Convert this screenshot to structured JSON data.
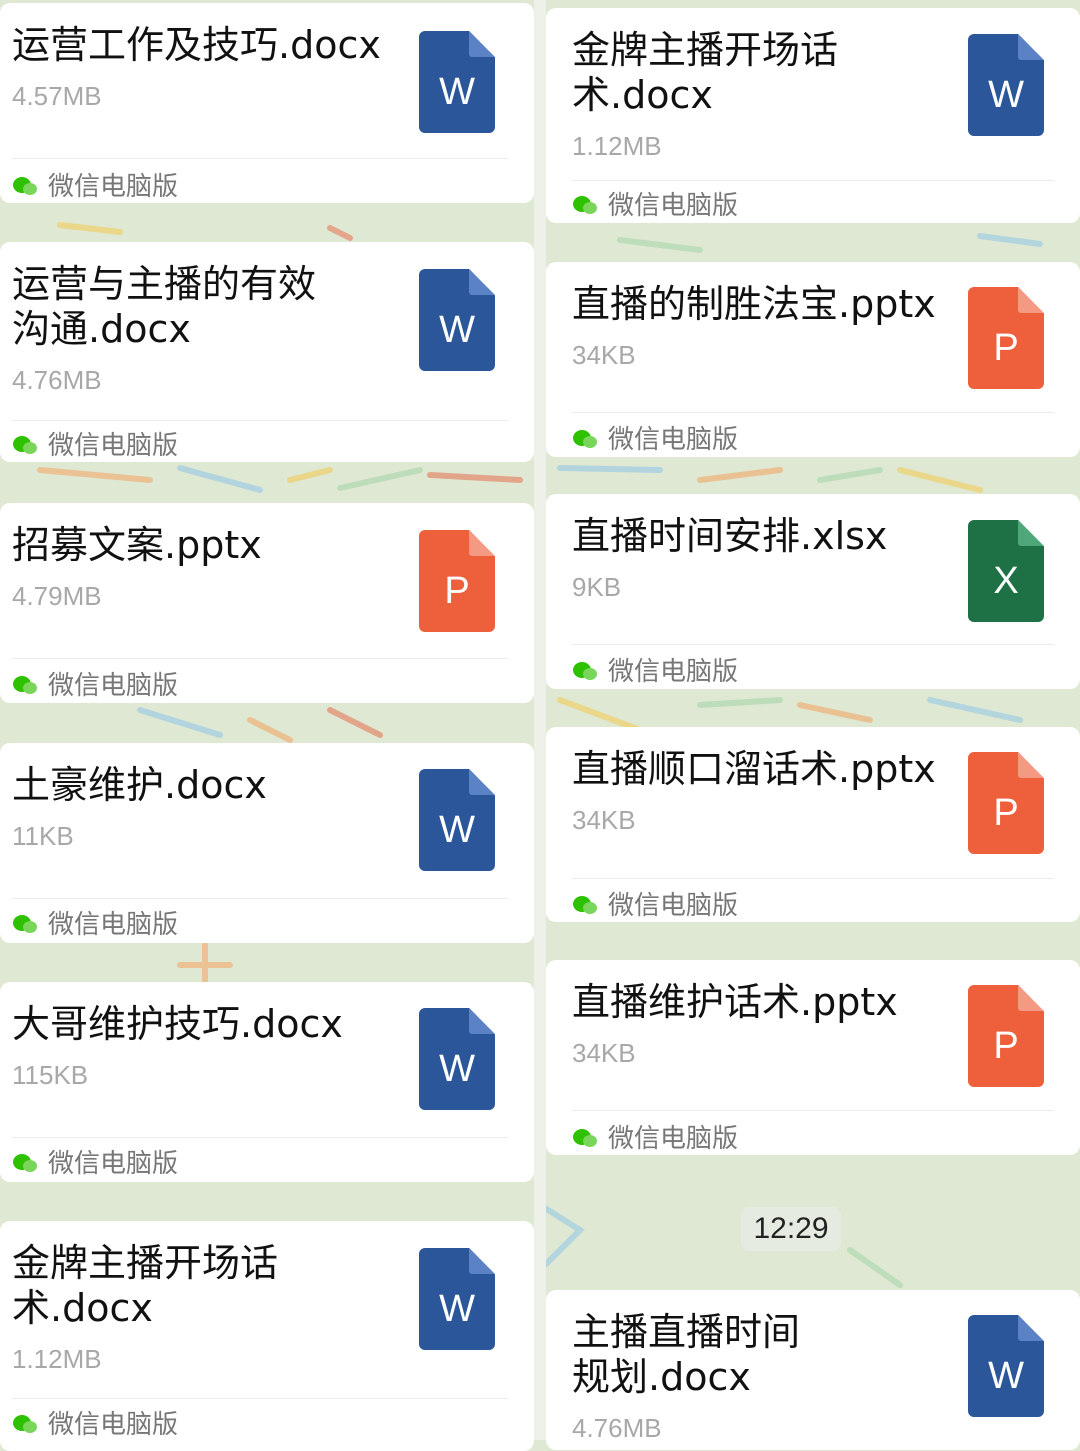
{
  "colors": {
    "word": "#2b579a",
    "word_fold": "#5b82c4",
    "ppt": "#ee5f3c",
    "ppt_fold": "#f59a82",
    "excel": "#1e7145",
    "excel_fold": "#4fa77a",
    "wechat_green": "#2dc100"
  },
  "source_label": "微信电脑版",
  "left_cards": [
    {
      "title": "运营工作及技巧.docx",
      "size": "4.57MB",
      "type": "word",
      "letter": "W",
      "icon": "word-file-icon"
    },
    {
      "title": "运营与主播的有效沟通.docx",
      "size": "4.76MB",
      "type": "word",
      "letter": "W",
      "icon": "word-file-icon"
    },
    {
      "title": "招募文案.pptx",
      "size": "4.79MB",
      "type": "ppt",
      "letter": "P",
      "icon": "powerpoint-file-icon"
    },
    {
      "title": "土豪维护.docx",
      "size": "11KB",
      "type": "word",
      "letter": "W",
      "icon": "word-file-icon"
    },
    {
      "title": "大哥维护技巧.docx",
      "size": "115KB",
      "type": "word",
      "letter": "W",
      "icon": "word-file-icon"
    },
    {
      "title": "金牌主播开场话术.docx",
      "size": "1.12MB",
      "type": "word",
      "letter": "W",
      "icon": "word-file-icon"
    }
  ],
  "right_cards": [
    {
      "title": "金牌主播开场话术.docx",
      "size": "1.12MB",
      "type": "word",
      "letter": "W",
      "icon": "word-file-icon"
    },
    {
      "title": "直播的制胜法宝.pptx",
      "size": "34KB",
      "type": "ppt",
      "letter": "P",
      "icon": "powerpoint-file-icon"
    },
    {
      "title": "直播时间安排.xlsx",
      "size": "9KB",
      "type": "excel",
      "letter": "X",
      "icon": "excel-file-icon"
    },
    {
      "title": "直播顺口溜话术.pptx",
      "size": "34KB",
      "type": "ppt",
      "letter": "P",
      "icon": "powerpoint-file-icon"
    },
    {
      "title": "直播维护话术.pptx",
      "size": "34KB",
      "type": "ppt",
      "letter": "P",
      "icon": "powerpoint-file-icon"
    },
    {
      "title": "主播直播时间规划.docx",
      "size": "4.76MB",
      "type": "word",
      "letter": "W",
      "icon": "word-file-icon"
    }
  ],
  "timestamp": "12:29"
}
